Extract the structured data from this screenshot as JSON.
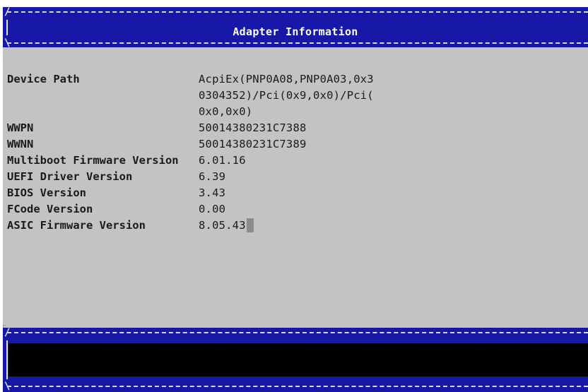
{
  "header": {
    "title": "Adapter Information"
  },
  "adapter_info": {
    "device_path": {
      "label": "Device Path",
      "lines": [
        "AcpiEx(PNP0A08,PNP0A03,0x3",
        "0304352)/Pci(0x9,0x0)/Pci(",
        "0x0,0x0)"
      ]
    },
    "wwpn": {
      "label": "WWPN",
      "value": "50014380231C7388"
    },
    "wwnn": {
      "label": "WWNN",
      "value": "50014380231C7389"
    },
    "multiboot_fw": {
      "label": "Multiboot Firmware Version",
      "value": "6.01.16"
    },
    "uefi_driver": {
      "label": "UEFI Driver Version",
      "value": "6.39"
    },
    "bios": {
      "label": "BIOS Version",
      "value": "3.43"
    },
    "fcode": {
      "label": "FCode Version",
      "value": "0.00"
    },
    "asic_fw": {
      "label": "ASIC Firmware Version",
      "value": "8.05.43"
    }
  },
  "status_bar": {
    "message": ""
  },
  "colors": {
    "banner_blue": "#1818a8",
    "panel_grey": "#c3c3c3",
    "status_black": "#000000",
    "text": "#1a1a1a"
  }
}
